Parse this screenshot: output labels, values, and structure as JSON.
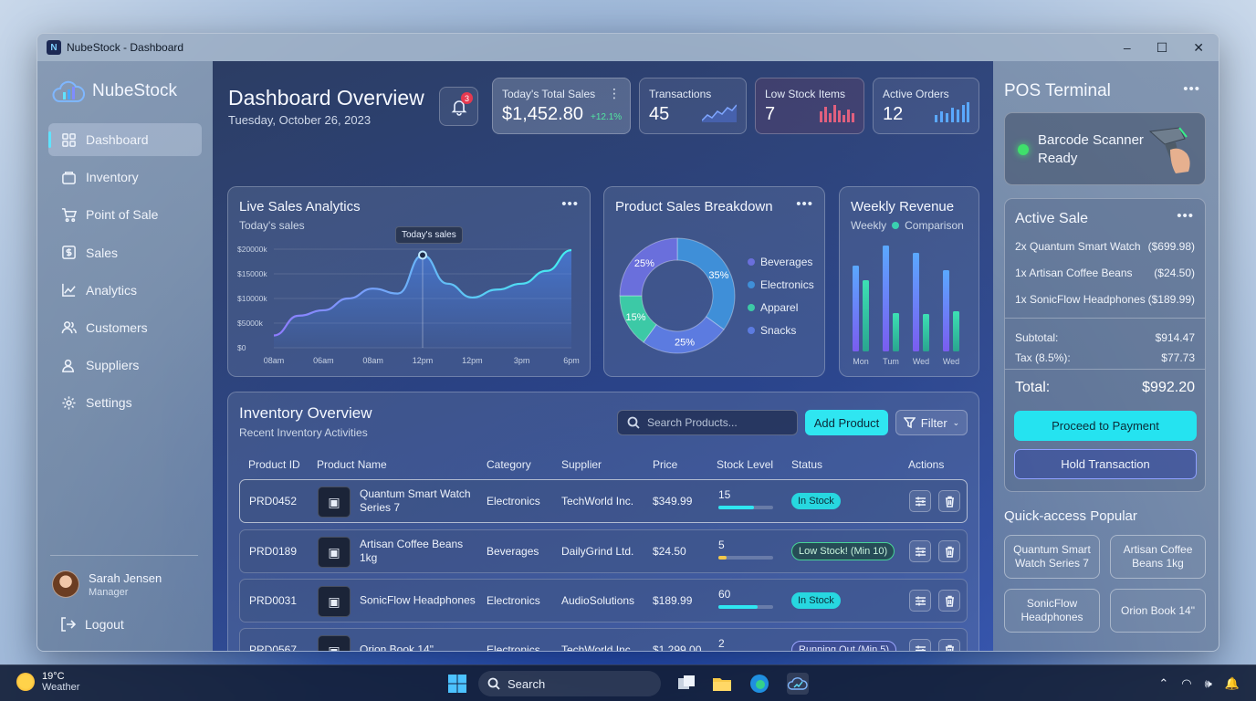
{
  "window": {
    "title": "NubeStock - Dashboard",
    "app_badge": "N",
    "controls": {
      "minimize": "–",
      "maximize": "☐",
      "close": "✕"
    }
  },
  "sidebar": {
    "brand": "NubeStock",
    "items": [
      {
        "label": "Dashboard",
        "icon": "grid-icon",
        "active": true
      },
      {
        "label": "Inventory",
        "icon": "box-icon"
      },
      {
        "label": "Point of Sale",
        "icon": "cart-icon"
      },
      {
        "label": "Sales",
        "icon": "dollar-icon"
      },
      {
        "label": "Analytics",
        "icon": "chart-icon"
      },
      {
        "label": "Customers",
        "icon": "users-icon"
      },
      {
        "label": "Suppliers",
        "icon": "supplier-icon"
      },
      {
        "label": "Settings",
        "icon": "gear-icon"
      }
    ],
    "user": {
      "name": "Sarah Jensen",
      "role": "Manager"
    },
    "logout": "Logout"
  },
  "header": {
    "title": "Dashboard Overview",
    "date": "Tuesday, October 26, 2023",
    "notifications": "3"
  },
  "kpis": [
    {
      "label": "Today's Total Sales",
      "value": "$1,452.80",
      "delta": "+12.1%"
    },
    {
      "label": "Transactions",
      "value": "45"
    },
    {
      "label": "Low Stock Items",
      "value": "7"
    },
    {
      "label": "Active Orders",
      "value": "12"
    }
  ],
  "live_sales": {
    "title": "Live Sales Analytics",
    "subtitle": "Today's sales",
    "tooltip": "Today's sales"
  },
  "breakdown": {
    "title": "Product Sales Breakdown"
  },
  "weekly": {
    "title": "Weekly Revenue",
    "legend_weekly": "Weekly",
    "legend_comparison": "Comparison"
  },
  "chart_data": [
    {
      "type": "area",
      "title": "Live Sales Analytics",
      "subtitle": "Today's sales",
      "x_ticks": [
        "08am",
        "06am",
        "08am",
        "12pm",
        "12pm",
        "3pm",
        "6pm"
      ],
      "y_ticks": [
        "$20000k",
        "$15000k",
        "$10000k",
        "$5000k",
        "$0"
      ],
      "ylim": [
        0,
        20000
      ],
      "x": [
        0,
        0.5,
        1,
        1.5,
        2,
        2.5,
        3,
        3.5,
        4,
        4.5,
        5,
        5.5,
        6
      ],
      "values": [
        2500,
        6500,
        7600,
        10000,
        12000,
        11000,
        18800,
        13000,
        10200,
        11800,
        13000,
        15600,
        19800
      ]
    },
    {
      "type": "pie",
      "title": "Product Sales Breakdown",
      "labels": [
        "Beverages",
        "Electronics",
        "Apparel",
        "Snacks"
      ],
      "values": [
        25,
        35,
        15,
        25
      ],
      "value_labels": [
        "25%",
        "35%",
        "15%",
        "25%"
      ],
      "colors": [
        "#6a6fdc",
        "#3f8fd8",
        "#3cc9a6",
        "#5c7be0"
      ]
    },
    {
      "type": "bar",
      "title": "Weekly Revenue",
      "categories": [
        "Mon",
        "Tum",
        "Wed",
        "Wed"
      ],
      "series": [
        {
          "name": "Weekly",
          "values": [
            9.4,
            11.6,
            10.8,
            8.9
          ],
          "color": "#6a7dea"
        },
        {
          "name": "Comparison",
          "values": [
            7.8,
            4.2,
            4.1,
            4.4
          ],
          "color": "#3ad0b0"
        }
      ],
      "series_colors": {
        "bars": [
          "#5b8cf0",
          "#39cfb1"
        ]
      },
      "ylim": [
        0,
        12
      ]
    }
  ],
  "inventory": {
    "title": "Inventory Overview",
    "subtitle": "Recent Inventory Activities",
    "search_placeholder": "Search Products...",
    "add_label": "Add Product",
    "filter_label": "Filter",
    "columns": [
      "Product ID",
      "Product Name",
      "Category",
      "Supplier",
      "Price",
      "Stock Level",
      "Status",
      "Actions"
    ],
    "rows": [
      {
        "id": "PRD0452",
        "name": "Quantum Smart Watch Series 7",
        "category": "Electronics",
        "supplier": "TechWorld Inc.",
        "price": "$349.99",
        "stock": "15",
        "stock_fraction": 0.65,
        "stock_color": "#2fe6f1",
        "status": "In Stock",
        "status_kind": "ok"
      },
      {
        "id": "PRD0189",
        "name": "Artisan Coffee Beans 1kg",
        "category": "Beverages",
        "supplier": "DailyGrind Ltd.",
        "price": "$24.50",
        "stock": "5",
        "stock_fraction": 0.15,
        "stock_color": "#f2c84a",
        "status": "Low Stock! (Min 10)",
        "status_kind": "warn"
      },
      {
        "id": "PRD0031",
        "name": "SonicFlow Headphones",
        "category": "Electronics",
        "supplier": "AudioSolutions",
        "price": "$189.99",
        "stock": "60",
        "stock_fraction": 0.72,
        "stock_color": "#2fe6f1",
        "status": "In Stock",
        "status_kind": "ok"
      },
      {
        "id": "PRD0567",
        "name": "Orion Book 14\"",
        "category": "Electronics",
        "supplier": "TechWorld Inc.",
        "price": "$1,299.00",
        "stock": "2",
        "stock_fraction": 0.06,
        "stock_color": "#9aa6ff",
        "status": "Running Out (Min 5)",
        "status_kind": "low"
      }
    ]
  },
  "pos": {
    "title": "POS Terminal",
    "scanner": "Barcode Scanner Ready",
    "active_sale_title": "Active Sale",
    "items": [
      {
        "label": "2x Quantum Smart Watch",
        "price": "($699.98)"
      },
      {
        "label": "1x Artisan Coffee Beans",
        "price": "($24.50)"
      },
      {
        "label": "1x SonicFlow Headphones",
        "price": "($189.99)"
      }
    ],
    "subtotal_label": "Subtotal:",
    "subtotal": "$914.47",
    "tax_label": "Tax (8.5%):",
    "tax": "$77.73",
    "total_label": "Total:",
    "total": "$992.20",
    "pay_label": "Proceed to Payment",
    "hold_label": "Hold Transaction",
    "quick_title": "Quick-access Popular",
    "quick": [
      "Quantum Smart Watch Series 7",
      "Artisan Coffee Beans 1kg",
      "SonicFlow Headphones",
      "Orion Book 14\""
    ]
  },
  "taskbar": {
    "temp": "19°C",
    "weather": "Weather",
    "search": "Search"
  }
}
